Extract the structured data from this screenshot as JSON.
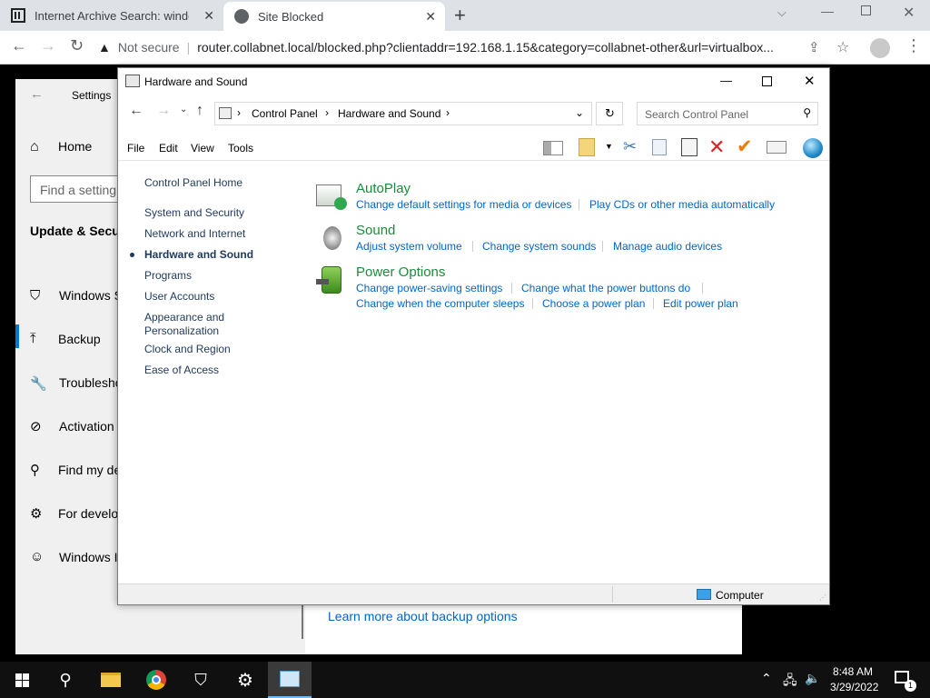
{
  "browser": {
    "tabs": [
      {
        "title": "Internet Archive Search: windows",
        "close": "✕"
      },
      {
        "title": "Site Blocked",
        "close": "✕"
      }
    ],
    "new_tab": "+",
    "security_label": "Not secure",
    "url": "router.collabnet.local/blocked.php?clientaddr=192.168.1.15&category=collabnet-other&url=virtualbox..."
  },
  "settings": {
    "title": "Settings",
    "home": "Home",
    "search_placeholder": "Find a setting",
    "section": "Update & Secur",
    "items": [
      "Windows S",
      "Backup",
      "Troublesho",
      "Activation",
      "Find my de",
      "For develo",
      "Windows I"
    ],
    "learn_more": "Learn more about backup options"
  },
  "control_panel": {
    "title": "Hardware and Sound",
    "breadcrumb": [
      "Control Panel",
      "Hardware and Sound"
    ],
    "search_placeholder": "Search Control Panel",
    "menu": [
      "File",
      "Edit",
      "View",
      "Tools"
    ],
    "nav": [
      "Control Panel Home",
      "System and Security",
      "Network and Internet",
      "Hardware and Sound",
      "Programs",
      "User Accounts",
      "Appearance and",
      "Personalization",
      "Clock and Region",
      "Ease of Access"
    ],
    "categories": {
      "autoplay": {
        "title": "AutoPlay",
        "links": [
          "Change default settings for media or devices",
          "Play CDs or other media automatically"
        ]
      },
      "sound": {
        "title": "Sound",
        "links": [
          "Adjust system volume",
          "Change system sounds",
          "Manage audio devices"
        ]
      },
      "power": {
        "title": "Power Options",
        "links": [
          "Change power-saving settings",
          "Change what the power buttons do",
          "Change when the computer sleeps",
          "Choose a power plan",
          "Edit power plan"
        ]
      }
    },
    "status": "Computer"
  },
  "taskbar": {
    "time": "8:48 AM",
    "date": "3/29/2022",
    "notification_count": "1"
  },
  "colors": {
    "link": "#0066cc",
    "category_title": "#1e8a3c",
    "taskbar": "#101010"
  }
}
